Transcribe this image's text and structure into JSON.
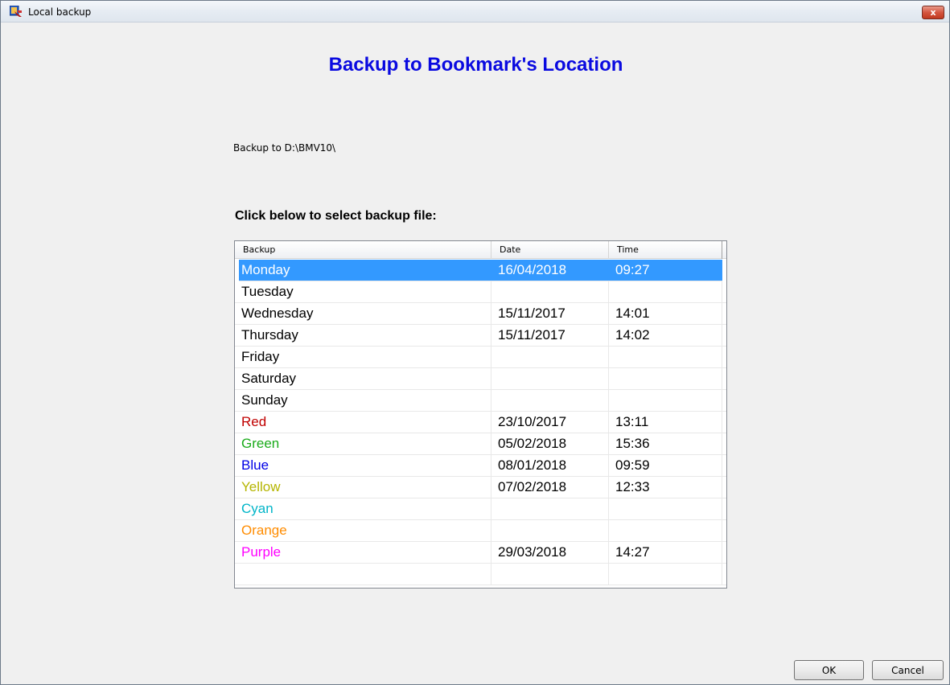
{
  "window": {
    "title": "Local backup",
    "close_glyph": "x"
  },
  "heading": "Backup to Bookmark's Location",
  "backup_path_label": "Backup to D:\\BMV10\\",
  "select_prompt": "Click below to select backup file:",
  "list": {
    "columns": [
      "Backup",
      "Date",
      "Time"
    ],
    "rows": [
      {
        "name": "Monday",
        "date": "16/04/2018",
        "time": "09:27",
        "color": "#ffffff",
        "selected": true
      },
      {
        "name": "Tuesday",
        "date": "",
        "time": "",
        "color": "#000000"
      },
      {
        "name": "Wednesday",
        "date": "15/11/2017",
        "time": "14:01",
        "color": "#000000"
      },
      {
        "name": "Thursday",
        "date": "15/11/2017",
        "time": "14:02",
        "color": "#000000"
      },
      {
        "name": "Friday",
        "date": "",
        "time": "",
        "color": "#000000"
      },
      {
        "name": "Saturday",
        "date": "",
        "time": "",
        "color": "#000000"
      },
      {
        "name": "Sunday",
        "date": "",
        "time": "",
        "color": "#000000"
      },
      {
        "name": "Red",
        "date": "23/10/2017",
        "time": "13:11",
        "color": "#c00000"
      },
      {
        "name": "Green",
        "date": "05/02/2018",
        "time": "15:36",
        "color": "#1aab1a"
      },
      {
        "name": "Blue",
        "date": "08/01/2018",
        "time": "09:59",
        "color": "#0000e6"
      },
      {
        "name": "Yellow",
        "date": "07/02/2018",
        "time": "12:33",
        "color": "#b5b500"
      },
      {
        "name": "Cyan",
        "date": "",
        "time": "",
        "color": "#00b5c8"
      },
      {
        "name": "Orange",
        "date": "",
        "time": "",
        "color": "#ff8c00"
      },
      {
        "name": "Purple",
        "date": "29/03/2018",
        "time": "14:27",
        "color": "#ff00ff"
      },
      {
        "name": "",
        "date": "",
        "time": "",
        "color": "#000000"
      }
    ]
  },
  "buttons": {
    "ok": "OK",
    "cancel": "Cancel"
  },
  "colors": {
    "heading": "#0a0ae0",
    "selection": "#3399ff"
  }
}
